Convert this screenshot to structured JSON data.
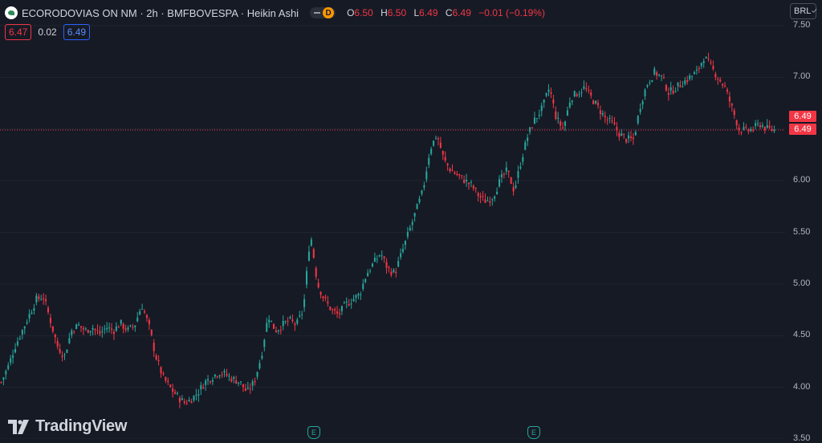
{
  "header": {
    "symbol_title": "ECORODOVIAS ON NM · 2h · BMFBOVESPA · Heikin Ashi",
    "interval_badge": "D",
    "ohlc": {
      "o_label": "O",
      "o_value": "6.50",
      "h_label": "H",
      "h_value": "6.50",
      "l_label": "L",
      "l_value": "6.49",
      "c_label": "C",
      "c_value": "6.49",
      "change": "−0.01 (−0.19%)"
    },
    "sell_price": "6.47",
    "spread": "0.02",
    "buy_price": "6.49"
  },
  "currency": "BRL",
  "y_axis_labels": [
    "7.50",
    "7.00",
    "6.50",
    "6.00",
    "5.50",
    "5.00",
    "4.50",
    "4.00",
    "3.50"
  ],
  "price_tags": [
    "6.49",
    "6.49"
  ],
  "branding": "TradingView",
  "earnings_marker": "E",
  "colors": {
    "up": "#26a69a",
    "down": "#f23645",
    "background": "#161a25",
    "grid": "#1f2430"
  },
  "chart_data": {
    "type": "candlestick",
    "chart_style": "Heikin Ashi",
    "ylim": [
      3.5,
      7.5
    ],
    "y_ticks": [
      3.5,
      4.0,
      4.5,
      5.0,
      5.5,
      6.0,
      6.5,
      7.0,
      7.5
    ],
    "last_price": 6.49,
    "close_path": [
      4.05,
      4.2,
      4.4,
      4.55,
      4.7,
      4.85,
      4.88,
      4.65,
      4.4,
      4.3,
      4.55,
      4.6,
      4.55,
      4.58,
      4.52,
      4.58,
      4.55,
      4.62,
      4.55,
      4.6,
      4.8,
      4.6,
      4.3,
      4.1,
      4.0,
      3.92,
      3.85,
      3.88,
      3.95,
      4.05,
      4.1,
      4.15,
      4.12,
      4.08,
      4.05,
      3.95,
      4.05,
      4.3,
      4.7,
      4.55,
      4.6,
      4.65,
      4.6,
      4.75,
      5.5,
      5.0,
      4.85,
      4.75,
      4.7,
      4.8,
      4.85,
      4.9,
      5.1,
      5.2,
      5.3,
      5.15,
      5.1,
      5.3,
      5.5,
      5.7,
      5.9,
      6.3,
      6.45,
      6.2,
      6.1,
      6.05,
      6.0,
      5.95,
      5.85,
      5.8,
      5.85,
      6.0,
      6.1,
      5.9,
      6.2,
      6.45,
      6.6,
      6.7,
      6.9,
      6.6,
      6.5,
      6.8,
      6.85,
      6.9,
      6.8,
      6.7,
      6.6,
      6.55,
      6.45,
      6.4,
      6.4,
      6.75,
      6.95,
      7.05,
      7.0,
      6.85,
      6.9,
      6.95,
      7.0,
      7.05,
      7.2,
      7.1,
      7.0,
      6.9,
      6.7,
      6.5,
      6.48,
      6.5,
      6.55,
      6.5,
      6.49
    ],
    "x_label_sample": "2h bars",
    "earnings_dates_marked": 2
  }
}
